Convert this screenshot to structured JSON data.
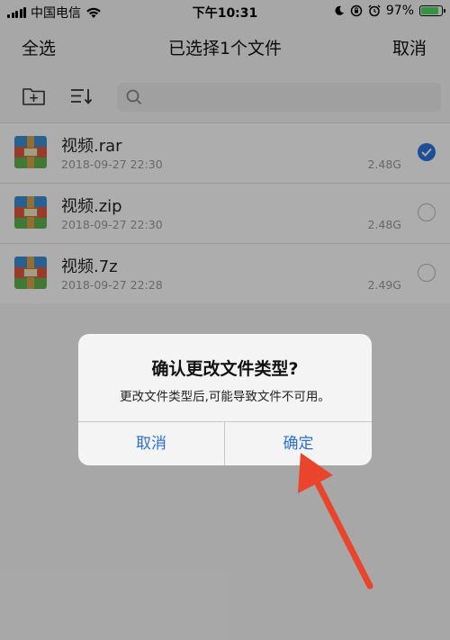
{
  "status_bar": {
    "carrier": "中国电信",
    "time": "下午10:31",
    "battery_percent": "97%",
    "battery_level": 0.97,
    "icons": [
      "signal-icon",
      "wifi-icon",
      "moon-icon",
      "rotation-lock-icon",
      "alarm-icon",
      "battery-icon"
    ]
  },
  "nav": {
    "select_all": "全选",
    "title": "已选择1个文件",
    "cancel": "取消"
  },
  "toolbar": {
    "icons": [
      "new-folder-icon",
      "sort-icon",
      "search-icon"
    ]
  },
  "files": [
    {
      "name": "视频.rar",
      "date": "2018-09-27 22:30",
      "size": "2.48G",
      "checked": true
    },
    {
      "name": "视频.zip",
      "date": "2018-09-27 22:30",
      "size": "2.48G",
      "checked": false
    },
    {
      "name": "视频.7z",
      "date": "2018-09-27 22:28",
      "size": "2.49G",
      "checked": false
    }
  ],
  "dialog": {
    "title": "确认更改文件类型?",
    "message": "更改文件类型后,可能导致文件不可用。",
    "cancel_label": "取消",
    "confirm_label": "确定"
  },
  "colors": {
    "accent": "#2d6fd8",
    "arrow": "#e8452c",
    "battery": "#4cd964"
  }
}
